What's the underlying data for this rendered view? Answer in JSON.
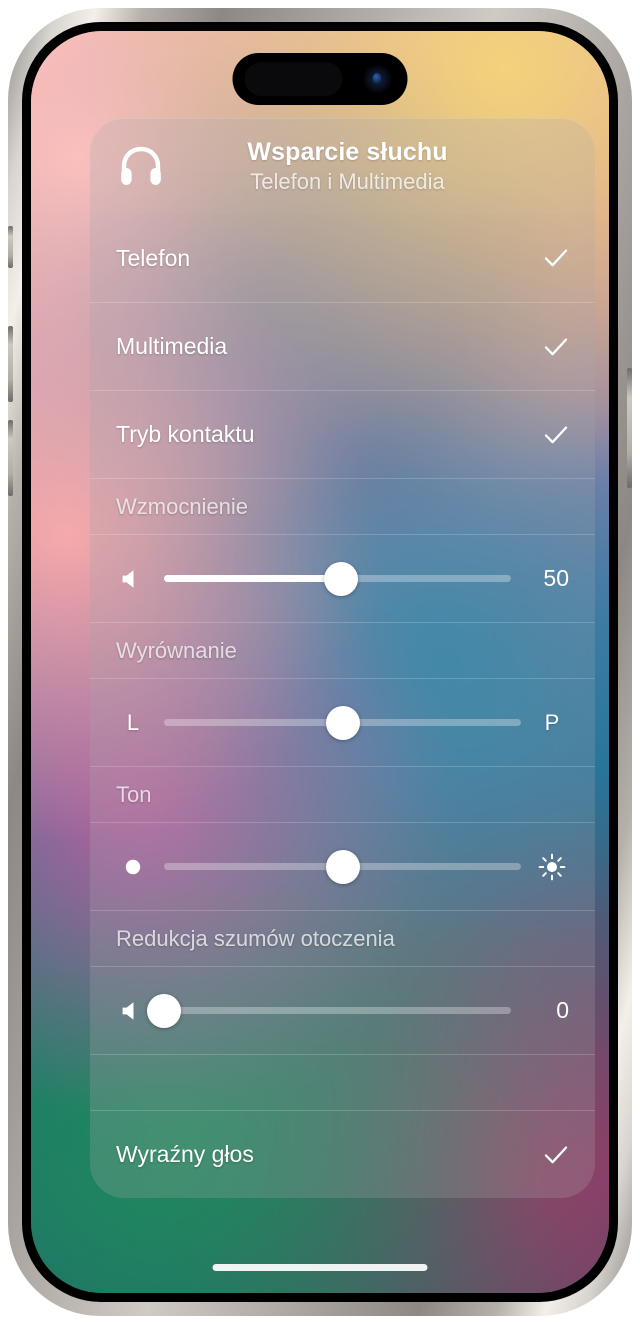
{
  "header": {
    "icon": "headphones-icon",
    "title": "Wsparcie słuchu",
    "subtitle": "Telefon i Multimedia"
  },
  "toggles": [
    {
      "label": "Telefon",
      "checked": true,
      "icon": "checkmark-icon"
    },
    {
      "label": "Multimedia",
      "checked": true,
      "icon": "checkmark-icon"
    },
    {
      "label": "Tryb kontaktu",
      "checked": true,
      "icon": "checkmark-icon"
    }
  ],
  "sections": [
    {
      "title": "Wzmocnienie",
      "slider": {
        "left_icon": "speaker-icon",
        "right_label": "50",
        "value": 50,
        "min": 0,
        "max": 100,
        "percent": 51,
        "filled": true
      }
    },
    {
      "title": "Wyrównanie",
      "slider": {
        "left_label": "L",
        "right_label": "P",
        "value": 0,
        "min": -100,
        "max": 100,
        "percent": 50,
        "filled": false
      }
    },
    {
      "title": "Ton",
      "slider": {
        "left_icon": "dot-icon",
        "right_icon": "sun-icon",
        "value": 50,
        "min": 0,
        "max": 100,
        "percent": 50,
        "filled": false
      }
    },
    {
      "title": "Redukcja szumów otoczenia",
      "slider": {
        "left_icon": "speaker-icon",
        "right_label": "0",
        "value": 0,
        "min": 0,
        "max": 100,
        "percent": 0,
        "filled": false
      }
    }
  ],
  "bottom_toggle": {
    "label": "Wyraźny głos",
    "checked": true,
    "icon": "checkmark-icon"
  },
  "colors": {
    "accent": "#ffffff",
    "panel_tint": "rgba(150,150,155,0.22)",
    "track_inactive": "rgba(255,255,255,0.30)",
    "text_primary": "#ffffff",
    "text_secondary": "rgba(255,255,255,0.74)"
  }
}
